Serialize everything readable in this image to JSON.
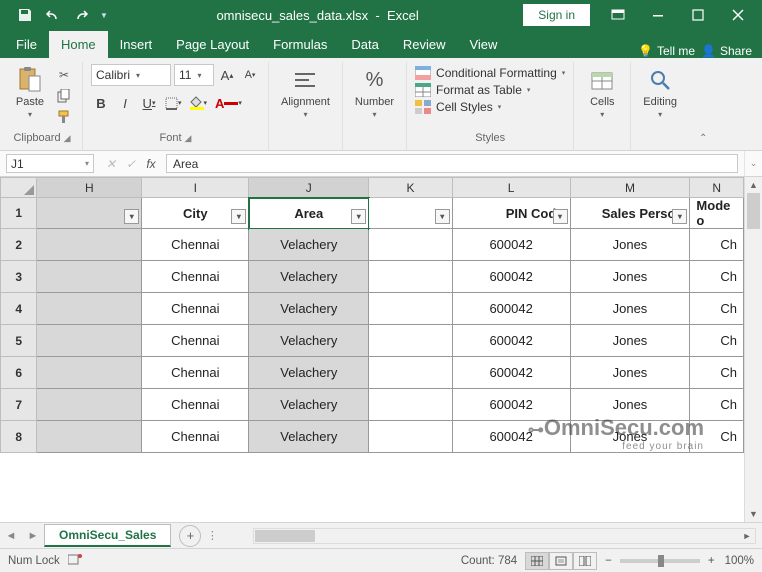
{
  "title": {
    "file": "omnisecu_sales_data.xlsx",
    "app": "Excel",
    "signin": "Sign in"
  },
  "tabs": {
    "file": "File",
    "home": "Home",
    "insert": "Insert",
    "pagelayout": "Page Layout",
    "formulas": "Formulas",
    "data": "Data",
    "review": "Review",
    "view": "View",
    "tellme": "Tell me",
    "share": "Share"
  },
  "ribbon": {
    "clipboard": {
      "paste": "Paste",
      "label": "Clipboard"
    },
    "font": {
      "name": "Calibri",
      "size": "11",
      "label": "Font"
    },
    "alignment": {
      "btn": "Alignment",
      "label": ""
    },
    "number": {
      "btn": "Number",
      "label": ""
    },
    "styles": {
      "cf": "Conditional Formatting",
      "table": "Format as Table",
      "cell": "Cell Styles",
      "label": "Styles"
    },
    "cells": {
      "btn": "Cells"
    },
    "editing": {
      "btn": "Editing"
    }
  },
  "namebox": "J1",
  "formula": "Area",
  "columns": [
    "H",
    "I",
    "J",
    "K",
    "L",
    "M",
    "N"
  ],
  "headers": {
    "I": "City",
    "J": "Area",
    "L": "PIN Code",
    "M": "Sales Person",
    "N": "Mode o"
  },
  "rows": [
    {
      "n": "2",
      "I": "Chennai",
      "J": "Velachery",
      "L": "600042",
      "M": "Jones",
      "N": "Ch"
    },
    {
      "n": "3",
      "I": "Chennai",
      "J": "Velachery",
      "L": "600042",
      "M": "Jones",
      "N": "Ch"
    },
    {
      "n": "4",
      "I": "Chennai",
      "J": "Velachery",
      "L": "600042",
      "M": "Jones",
      "N": "Ch"
    },
    {
      "n": "5",
      "I": "Chennai",
      "J": "Velachery",
      "L": "600042",
      "M": "Jones",
      "N": "Ch"
    },
    {
      "n": "6",
      "I": "Chennai",
      "J": "Velachery",
      "L": "600042",
      "M": "Jones",
      "N": "Ch"
    },
    {
      "n": "7",
      "I": "Chennai",
      "J": "Velachery",
      "L": "600042",
      "M": "Jones",
      "N": "Ch"
    },
    {
      "n": "8",
      "I": "Chennai",
      "J": "Velachery",
      "L": "600042",
      "M": "Jones",
      "N": "Ch"
    }
  ],
  "sheet": {
    "name": "OmniSecu_Sales"
  },
  "status": {
    "numlock": "Num Lock",
    "count": "Count: 784",
    "zoom": "100%"
  },
  "watermark": {
    "main": "OmniSecu.com",
    "tag": "feed your brain"
  }
}
